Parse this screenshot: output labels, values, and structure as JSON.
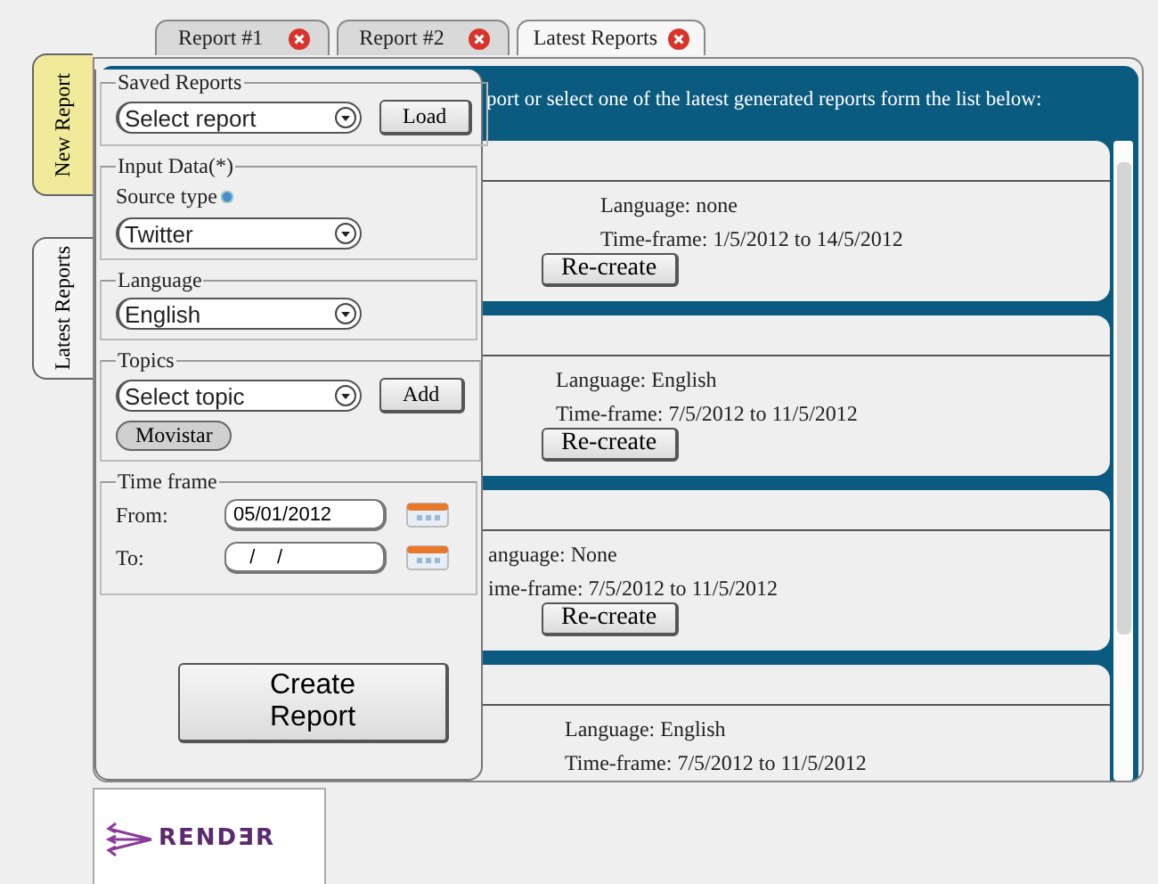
{
  "tabs": [
    {
      "label": "Report #1",
      "selected": false
    },
    {
      "label": "Report #2",
      "selected": false
    },
    {
      "label": "Latest Reports",
      "selected": true
    }
  ],
  "side_tabs": [
    {
      "label": "New Report",
      "selected": true
    },
    {
      "label": "Latest Reports",
      "selected": false
    }
  ],
  "banner": {
    "text": "port or select one of the latest generated reports form the list below:"
  },
  "reports": [
    {
      "language": "Language: none",
      "time_frame": "Time-frame: 1/5/2012 to 14/5/2012",
      "button": "Re-create"
    },
    {
      "language": "Language: English",
      "time_frame": "Time-frame: 7/5/2012 to 11/5/2012",
      "button": "Re-create"
    },
    {
      "language": "anguage: None",
      "time_frame": "ime-frame: 7/5/2012 to 11/5/2012",
      "button": "Re-create"
    },
    {
      "language": "Language: English",
      "time_frame": "Time-frame: 7/5/2012 to 11/5/2012"
    }
  ],
  "form": {
    "saved_reports": {
      "legend": "Saved Reports",
      "select": "Select report",
      "button": "Load"
    },
    "input_data": {
      "legend": "Input Data(*)",
      "source_label": "Source type",
      "select": "Twitter"
    },
    "language": {
      "legend": "Language",
      "select": "English"
    },
    "topics": {
      "legend": "Topics",
      "select": "Select topic",
      "button": "Add",
      "chips": [
        "Movistar"
      ]
    },
    "time_frame": {
      "legend": "Time frame",
      "from_label": "From:",
      "from_value": "05/01/2012",
      "to_label": "To:",
      "to_value": "   /    /"
    },
    "submit": "Create Report"
  },
  "logo": {
    "text": "RENDƎR"
  }
}
